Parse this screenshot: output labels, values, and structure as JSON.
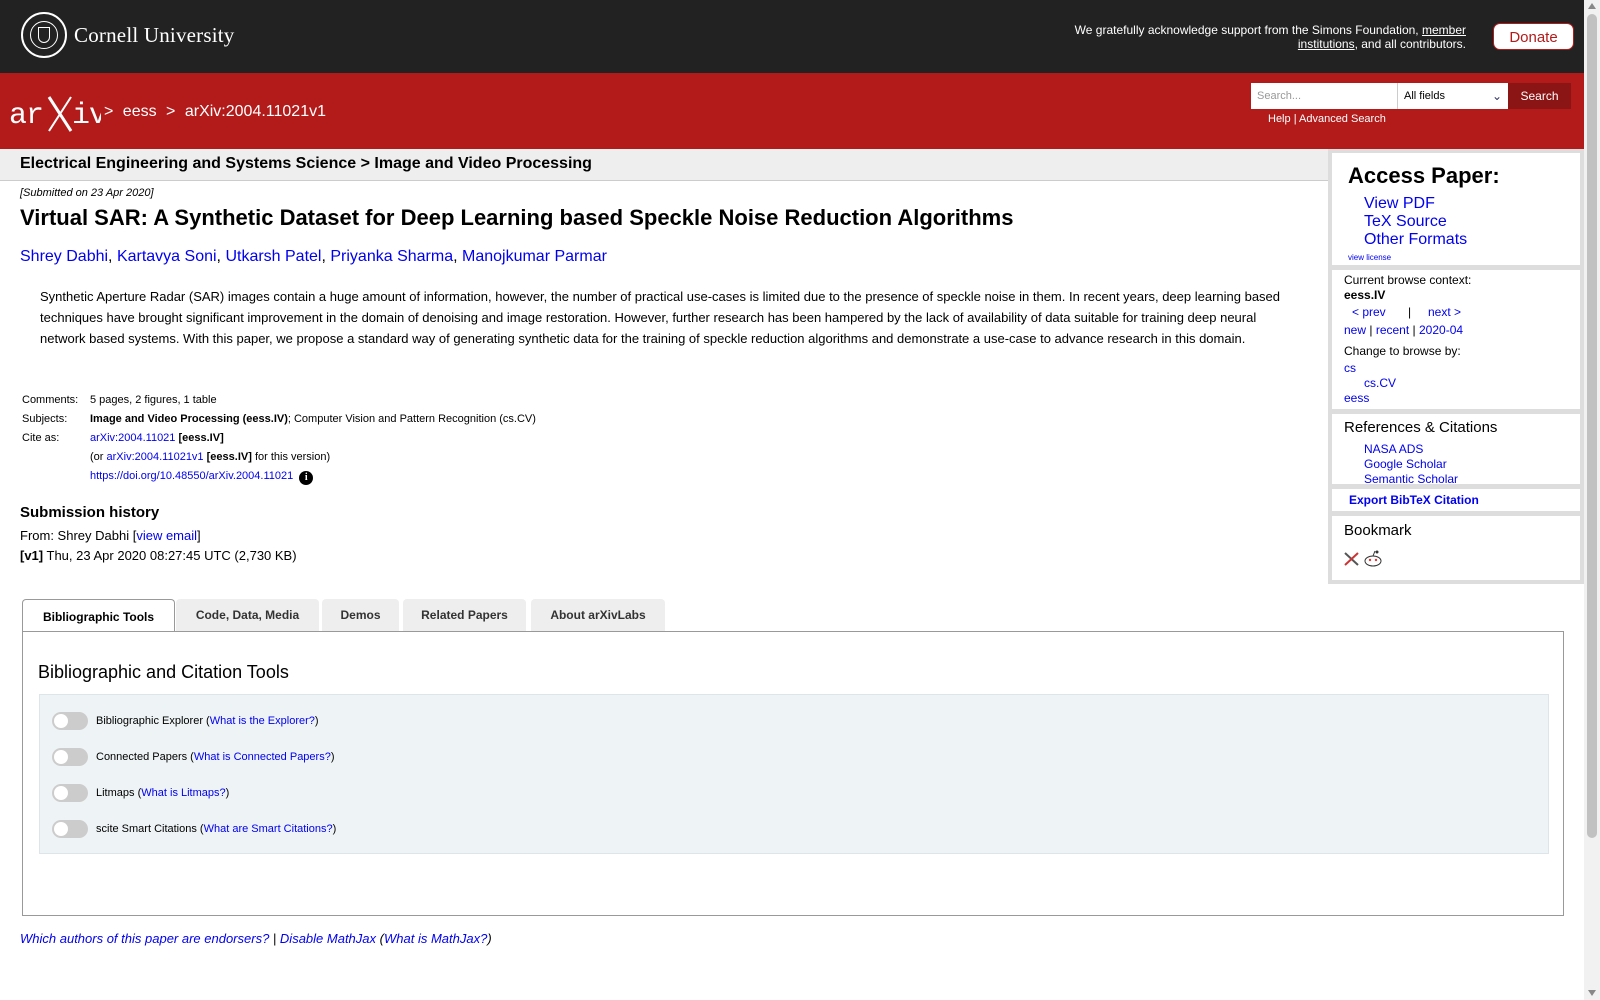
{
  "top_bar": {
    "brand": "Cornell University",
    "support_text": "We gratefully acknowledge support from the Simons Foundation,",
    "support_link": "member institutions",
    "support_tail": ", and all contributors.",
    "donate_label": "Donate"
  },
  "header": {
    "breadcrumbs": [
      ">",
      "eess",
      ">",
      "arXiv:2004.11021v1"
    ],
    "search_placeholder": "Search...",
    "search_field": "All fields",
    "search_button": "Search",
    "help_link": "Help",
    "separator": "|",
    "advanced_link": "Advanced Search"
  },
  "category": {
    "main": "Electrical Engineering and Systems Science",
    "sep": ">",
    "sub": "Image and Video Processing"
  },
  "paper": {
    "submitted": "[Submitted on 23 Apr 2020]",
    "title": "Virtual SAR: A Synthetic Dataset for Deep Learning based Speckle Noise Reduction Algorithms",
    "authors": [
      "Shrey Dabhi",
      "Kartavya Soni",
      "Utkarsh Patel",
      "Priyanka Sharma",
      "Manojkumar Parmar"
    ],
    "abstract": "Synthetic Aperture Radar (SAR) images contain a huge amount of information, however, the number of practical use-cases is limited due to the presence of speckle noise in them. In recent years, deep learning based techniques have brought significant improvement in the domain of denoising and image restoration. However, further research has been hampered by the lack of availability of data suitable for training deep neural network based systems. With this paper, we propose a standard way of generating synthetic data for the training of speckle reduction algorithms and demonstrate a use-case to advance research in this domain.",
    "comments_label": "Comments:",
    "comments": "5 pages, 2 figures, 1 table",
    "subjects_label": "Subjects:",
    "subject_primary": "Image and Video Processing (eess.IV)",
    "subject_rest": "; Computer Vision and Pattern Recognition (cs.CV)",
    "cite_label": "Cite as:",
    "cite_id": "arXiv:2004.11021",
    "cite_cat": "[eess.IV]",
    "cite_or": "(or",
    "cite_version": "arXiv:2004.11021v1",
    "cite_version_cat": "[eess.IV]",
    "cite_version_tail": "for this version)",
    "doi": "https://doi.org/10.48550/arXiv.2004.11021"
  },
  "history": {
    "heading": "Submission history",
    "from_prefix": "From: Shrey Dabhi [",
    "view_email": "view email",
    "from_suffix": "]",
    "v1_label": "[v1]",
    "v1_text": "Thu, 23 Apr 2020 08:27:45 UTC (2,730 KB)"
  },
  "sidebar": {
    "access_heading": "Access Paper:",
    "view_pdf": "View PDF",
    "tex_source": "TeX Source",
    "other_formats": "Other Formats",
    "view_license": "view license",
    "context_label": "Current browse context:",
    "context_value": "eess.IV",
    "prev": "< prev",
    "pipe": "|",
    "next": "next >",
    "new": "new",
    "recent": "recent",
    "month": "2020-04",
    "change_label": "Change to browse by:",
    "browse_cs": "cs",
    "browse_cscv": "cs.CV",
    "browse_eess": "eess",
    "refs_heading": "References & Citations",
    "nasa": "NASA ADS",
    "google": "Google Scholar",
    "semantic": "Semantic Scholar",
    "bibtex": "Export BibTeX Citation",
    "bookmark_heading": "Bookmark"
  },
  "tabs": [
    "Bibliographic Tools",
    "Code, Data, Media",
    "Demos",
    "Related Papers",
    "About arXivLabs"
  ],
  "tools": {
    "heading": "Bibliographic and Citation Tools",
    "rows": [
      {
        "label": "Bibliographic Explorer",
        "link": "What is the Explorer?"
      },
      {
        "label": "Connected Papers",
        "link": "What is Connected Papers?"
      },
      {
        "label": "Litmaps",
        "link": "What is Litmaps?"
      },
      {
        "label": "scite Smart Citations",
        "link": "What are Smart Citations?"
      }
    ]
  },
  "footer": {
    "endorsers": "Which authors of this paper are endorsers?",
    "disable_mathjax": "Disable MathJax",
    "what_mathjax": "What is MathJax?"
  },
  "colors": {
    "arxiv_red": "#b31b1b",
    "top_bar": "#222222",
    "link": "#0000ee"
  }
}
